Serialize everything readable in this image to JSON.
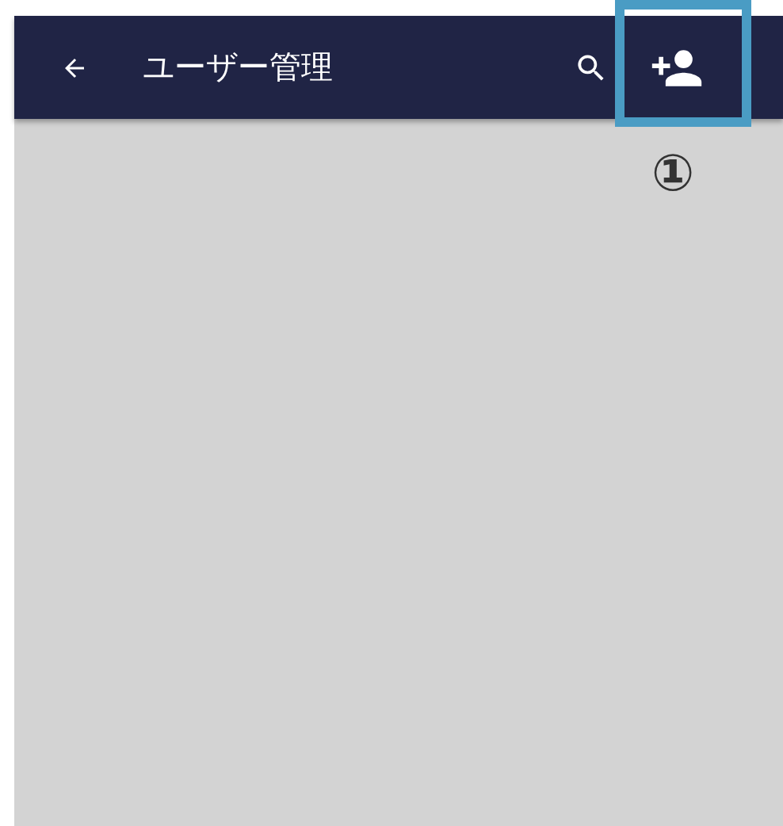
{
  "app_bar": {
    "title": "ユーザー管理"
  },
  "callout": {
    "label": "①"
  }
}
